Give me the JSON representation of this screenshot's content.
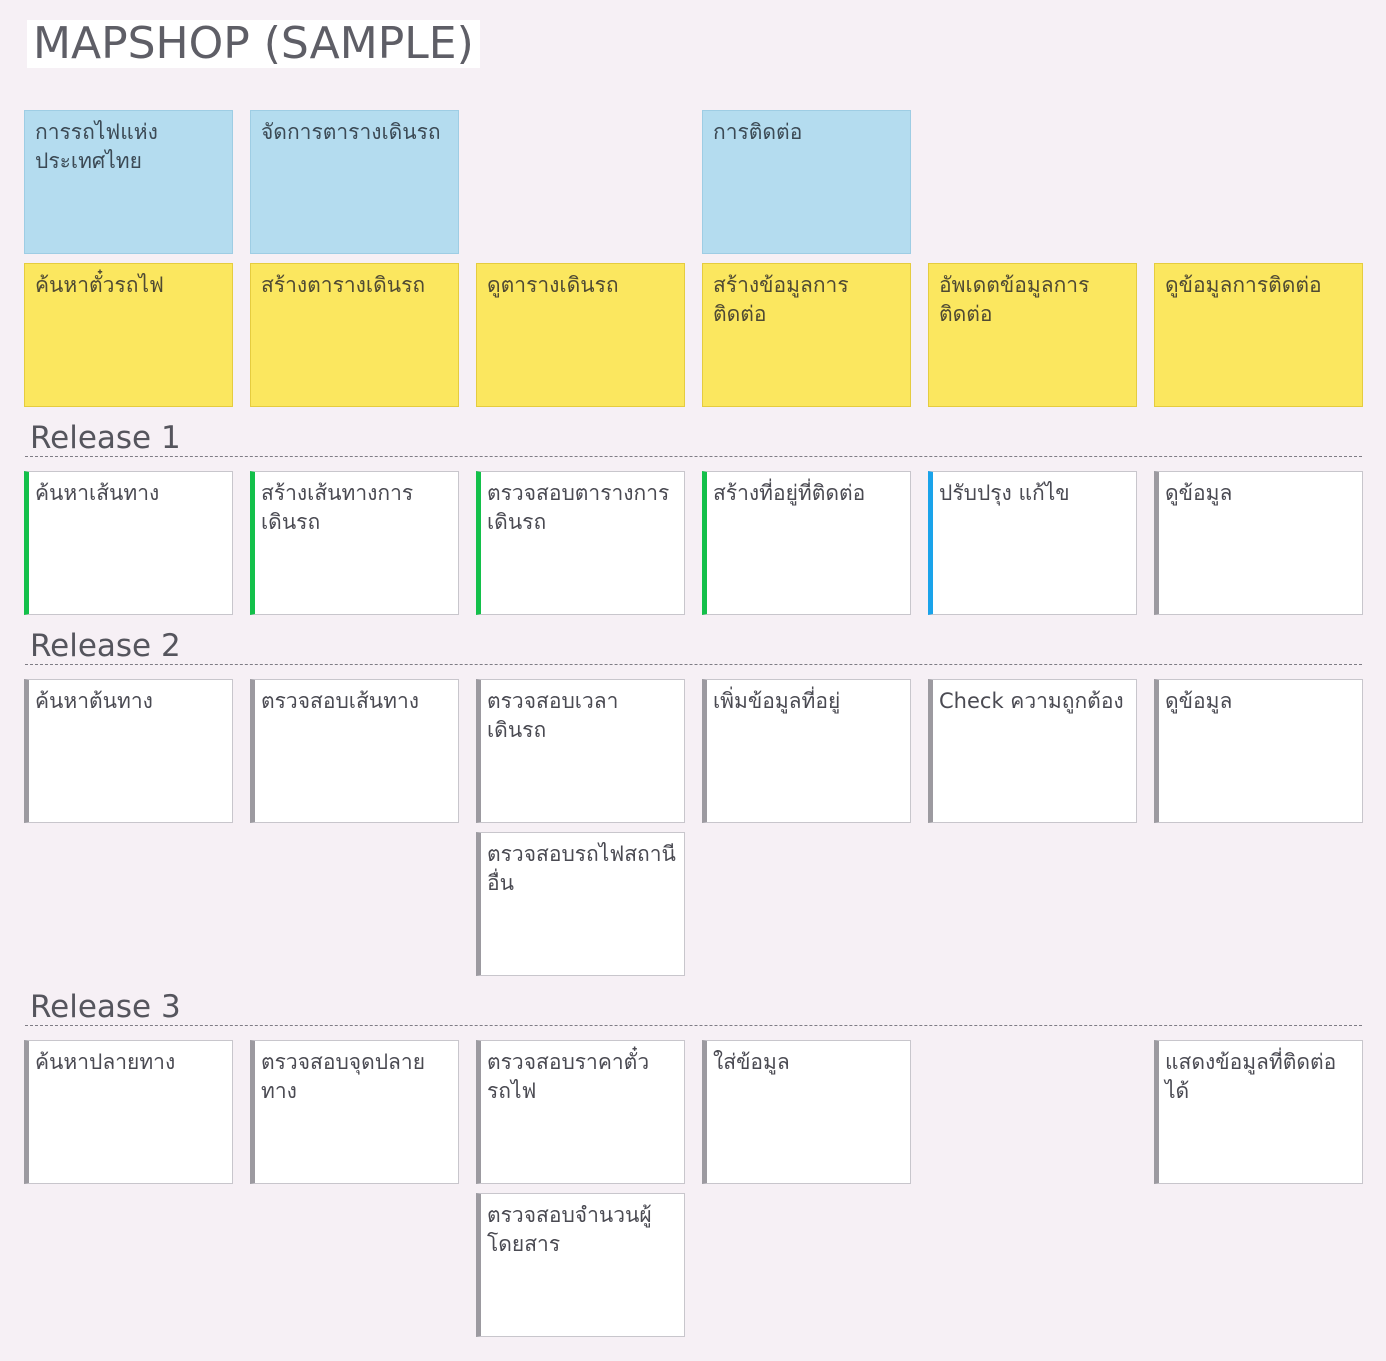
{
  "title": "MAPSHOP (SAMPLE)",
  "activities": [
    {
      "text": "การรถไฟแห่งประเทศไทย"
    },
    {
      "text": "จัดการตารางเดินรถ"
    },
    {
      "text": "การติดต่อ"
    }
  ],
  "tasks": [
    {
      "text": "ค้นหาตั๋วรถไฟ"
    },
    {
      "text": "สร้างตารางเดินรถ"
    },
    {
      "text": "ดูตารางเดินรถ"
    },
    {
      "text": "สร้างข้อมูลการติดต่อ"
    },
    {
      "text": "อัพเดตข้อมูลการติดต่อ"
    },
    {
      "text": "ดูข้อมูลการติดต่อ"
    }
  ],
  "releases": [
    {
      "label": "Release 1",
      "stories": [
        {
          "text": "ค้นหาเส้นทาง",
          "status": "green"
        },
        {
          "text": "สร้างเส้นทางการเดินรถ",
          "status": "green"
        },
        {
          "text": "ตรวจสอบตารางการเดินรถ",
          "status": "green"
        },
        {
          "text": "สร้างที่อยู่ที่ติดต่อ",
          "status": "green"
        },
        {
          "text": "ปรับปรุง แก้ไข",
          "status": "blue"
        },
        {
          "text": "ดูข้อมูล",
          "status": "gray"
        }
      ]
    },
    {
      "label": "Release 2",
      "stories": [
        {
          "text": "ค้นหาต้นทาง",
          "status": "gray"
        },
        {
          "text": "ตรวจสอบเส้นทาง",
          "status": "gray"
        },
        {
          "text": "ตรวจสอบเวลาเดินรถ",
          "status": "gray"
        },
        {
          "text": "ตรวจสอบรถไฟสถานีอื่น",
          "status": "gray"
        },
        {
          "text": "เพิ่มข้อมูลที่อยู่",
          "status": "gray"
        },
        {
          "text": "Check ความถูกต้อง",
          "status": "gray"
        },
        {
          "text": "ดูข้อมูล",
          "status": "gray"
        }
      ]
    },
    {
      "label": "Release 3",
      "stories": [
        {
          "text": "ค้นหาปลายทาง",
          "status": "gray"
        },
        {
          "text": "ตรวจสอบจุดปลายทาง",
          "status": "gray"
        },
        {
          "text": "ตรวจสอบราคาตั๋วรถไฟ",
          "status": "gray"
        },
        {
          "text": "ตรวจสอบจำนวนผู้โดยสาร",
          "status": "gray"
        },
        {
          "text": "ใส่ข้อมูล",
          "status": "gray"
        },
        {
          "text": "แสดงข้อมูลที่ติดต่อได้",
          "status": "gray"
        }
      ]
    }
  ],
  "status_colors": {
    "green": "#13c04a",
    "blue": "#1aa3ea",
    "gray": "#9c9aa0"
  }
}
